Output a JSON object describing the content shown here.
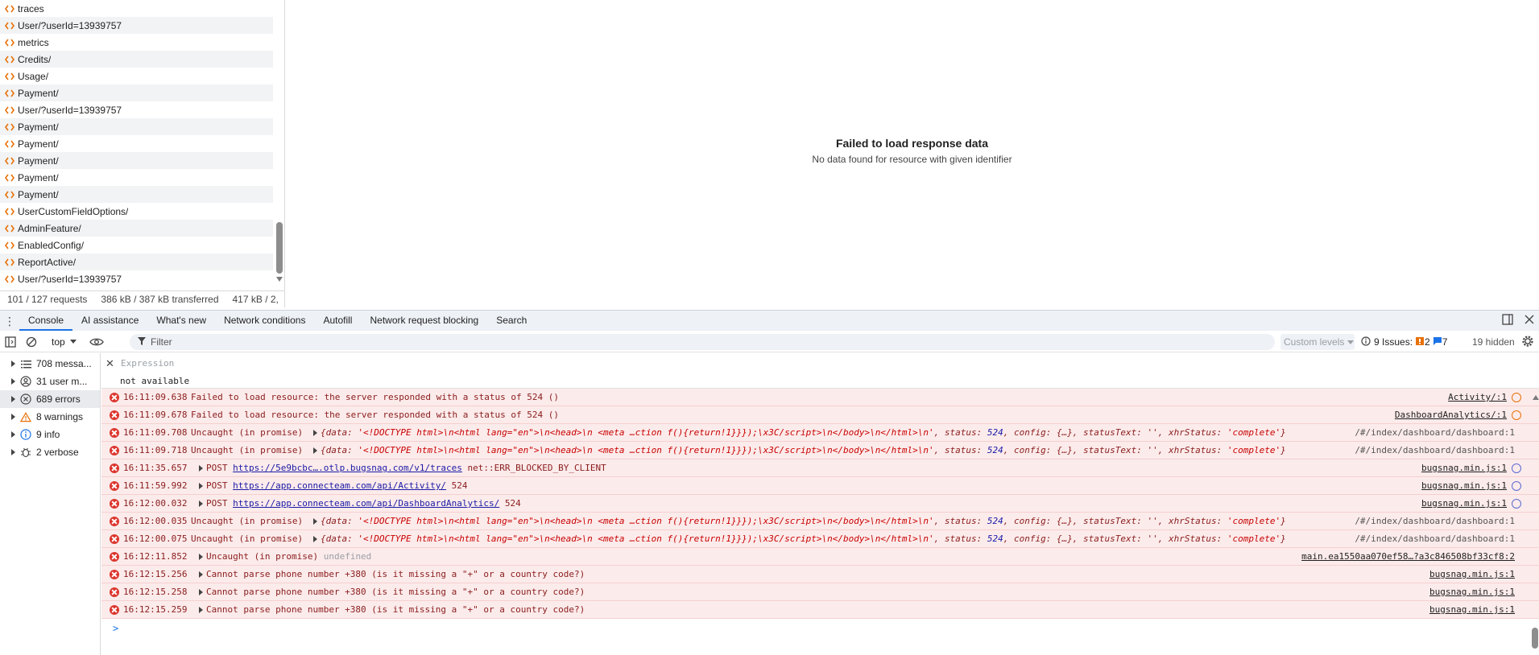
{
  "network": {
    "requests": [
      "traces",
      "User/?userId=13939757",
      "metrics",
      "Credits/",
      "Usage/",
      "Payment/",
      "User/?userId=13939757",
      "Payment/",
      "Payment/",
      "Payment/",
      "Payment/",
      "Payment/",
      "UserCustomFieldOptions/",
      "AdminFeature/",
      "EnabledConfig/",
      "ReportActive/",
      "User/?userId=13939757"
    ],
    "status_requests": "101 / 127 requests",
    "status_transferred": "386 kB / 387 kB transferred",
    "status_resources": "417 kB / 2,",
    "response_title": "Failed to load response data",
    "response_subtitle": "No data found for resource with given identifier"
  },
  "drawer": {
    "menu_icon": "more-vertical-icon",
    "tabs": [
      "Console",
      "AI assistance",
      "What's new",
      "Network conditions",
      "Autofill",
      "Network request blocking",
      "Search"
    ],
    "active_tab": "Console"
  },
  "toolbar": {
    "context": "top",
    "filter_placeholder": "Filter",
    "levels": "Custom levels",
    "issues_label": "9 Issues:",
    "issues_warnings": "2",
    "issues_info": "7",
    "hidden": "19 hidden"
  },
  "sidebar": {
    "items": [
      {
        "label": "708 messa...",
        "icon": "list-icon"
      },
      {
        "label": "31 user m...",
        "icon": "user-icon"
      },
      {
        "label": "689 errors",
        "icon": "error-icon"
      },
      {
        "label": "8 warnings",
        "icon": "warning-icon"
      },
      {
        "label": "9 info",
        "icon": "info-icon"
      },
      {
        "label": "2 verbose",
        "icon": "bug-icon"
      }
    ]
  },
  "live_expression": {
    "placeholder": "Expression",
    "value": "not available"
  },
  "console": {
    "obj_prefix": "{data: ",
    "obj_html": "'<!DOCTYPE html>\\n<html lang=\"en\">\\n<head>\\n    <meta …ction f(){return!1}}});\\x3C/script>\\n</body>\\n</html>\\n'",
    "obj_status_key": ", status: ",
    "obj_status": "524",
    "obj_rest_key": ", config: {…}, statusText: '', xhrStatus: ",
    "obj_rest_val": "'complete'",
    "obj_end": "}",
    "rows": [
      {
        "time": "16:11:09.638",
        "message": "Failed to load resource: the server responded with a status of 524 ()",
        "source": "Activity/:1"
      },
      {
        "time": "16:11:09.678",
        "message": "Failed to load resource: the server responded with a status of 524 ()",
        "source": "DashboardAnalytics/:1"
      },
      {
        "time": "16:11:09.708",
        "message": "Uncaught (in promise)",
        "source": "/#/index/dashboard/dashboard:1"
      },
      {
        "time": "16:11:09.718",
        "message": "Uncaught (in promise)",
        "source": "/#/index/dashboard/dashboard:1"
      },
      {
        "time": "16:11:35.657",
        "method": "POST",
        "url": "https://5e9bcbc….otlp.bugsnag.com/v1/traces",
        "suffix": " net::ERR_BLOCKED_BY_CLIENT",
        "source": "bugsnag.min.js:1"
      },
      {
        "time": "16:11:59.992",
        "method": "POST",
        "url": "https://app.connecteam.com/api/Activity/",
        "suffix": " 524",
        "source": "bugsnag.min.js:1"
      },
      {
        "time": "16:12:00.032",
        "method": "POST",
        "url": "https://app.connecteam.com/api/DashboardAnalytics/",
        "suffix": " 524",
        "source": "bugsnag.min.js:1"
      },
      {
        "time": "16:12:00.035",
        "message": "Uncaught (in promise)",
        "source": "/#/index/dashboard/dashboard:1"
      },
      {
        "time": "16:12:00.075",
        "message": "Uncaught (in promise)",
        "source": "/#/index/dashboard/dashboard:1"
      },
      {
        "time": "16:12:11.852",
        "message": "Uncaught (in promise)",
        "extra": "undefined",
        "source": "main.ea1550aa070ef58…?a3c846508bf33cf8:2"
      },
      {
        "time": "16:12:15.256",
        "message": "Cannot parse phone number +380 (is it missing a \"+\" or a country code?)",
        "source": "bugsnag.min.js:1"
      },
      {
        "time": "16:12:15.258",
        "message": "Cannot parse phone number +380 (is it missing a \"+\" or a country code?)",
        "source": "bugsnag.min.js:1"
      },
      {
        "time": "16:12:15.259",
        "message": "Cannot parse phone number +380 (is it missing a \"+\" or a country code?)",
        "source": "bugsnag.min.js:1"
      }
    ]
  },
  "prompt": ">"
}
